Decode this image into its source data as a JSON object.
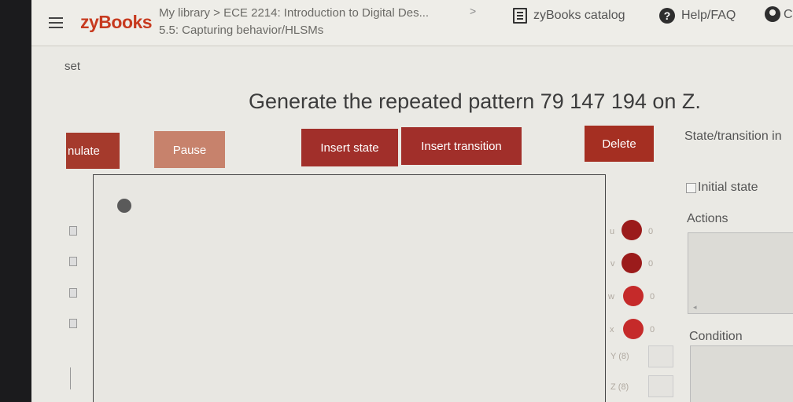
{
  "header": {
    "logo": "zyBooks",
    "breadcrumb_line1": "My library > ECE 2214: Introduction to Digital Des...",
    "breadcrumb_line2": "5.5: Capturing behavior/HLSMs",
    "breadcrumb_chevron": ">",
    "catalog_label": "zyBooks catalog",
    "help_label": "Help/FAQ",
    "user_initial_cut": "C"
  },
  "content": {
    "reset_label": "set",
    "prompt": "Generate the repeated pattern 79 147 194 on Z.",
    "buttons": {
      "simulate": "nulate",
      "pause": "Pause",
      "insert_state": "Insert state",
      "insert_transition": "Insert transition",
      "delete": "Delete"
    },
    "side_panel": {
      "heading": "State/transition in",
      "initial_state_label": "Initial state",
      "initial_state_checked": false,
      "actions_label": "Actions",
      "actions_value": "",
      "condition_label": "Condition",
      "condition_value": ""
    },
    "outputs": [
      {
        "name": "u",
        "value": "0"
      },
      {
        "name": "v",
        "value": "0"
      },
      {
        "name": "w",
        "value": "0"
      },
      {
        "name": "x",
        "value": "0"
      }
    ],
    "wide_outputs": [
      {
        "label": "Y (8)",
        "value": ""
      },
      {
        "label": "Z (8)",
        "value": ""
      }
    ]
  },
  "colors": {
    "brand": "#c73a1f",
    "button_primary": "#a12f2a",
    "button_disabled": "#c7826c",
    "signal_dark": "#9b1b1b",
    "signal_bright": "#c52a2a"
  },
  "icons": [
    "hamburger-icon",
    "catalog-icon",
    "help-icon",
    "user-icon"
  ]
}
